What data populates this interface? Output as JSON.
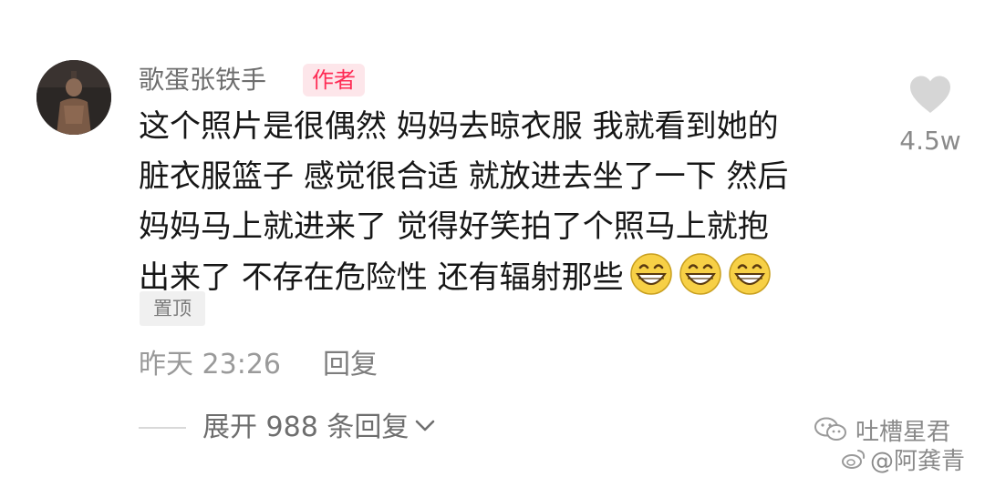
{
  "comment": {
    "username": "歌蛋张铁手",
    "author_badge": "作者",
    "text_lines": [
      "这个照片是很偶然 妈妈去晾衣服 我就看到她的",
      "脏衣服篮子 感觉很合适 就放进去坐了一下 然后",
      "妈妈马上就进来了 觉得好笑拍了个照马上就抱",
      "出来了 不存在危险性 还有辐射那些"
    ],
    "emoji": "grinning-face-icon",
    "emoji_count": 3,
    "pin_label": "置顶",
    "like_count": "4.5w",
    "timestamp": "昨天 23:26",
    "reply_label": "回复",
    "expand_label": "展开 988 条回复"
  },
  "watermark": {
    "line1": "吐槽星君",
    "line2": "@阿龚青"
  },
  "colors": {
    "badge_text": "#fe2c55",
    "badge_bg": "#fde6ea",
    "muted_text": "#9a9a9a",
    "body_text": "#161616"
  }
}
